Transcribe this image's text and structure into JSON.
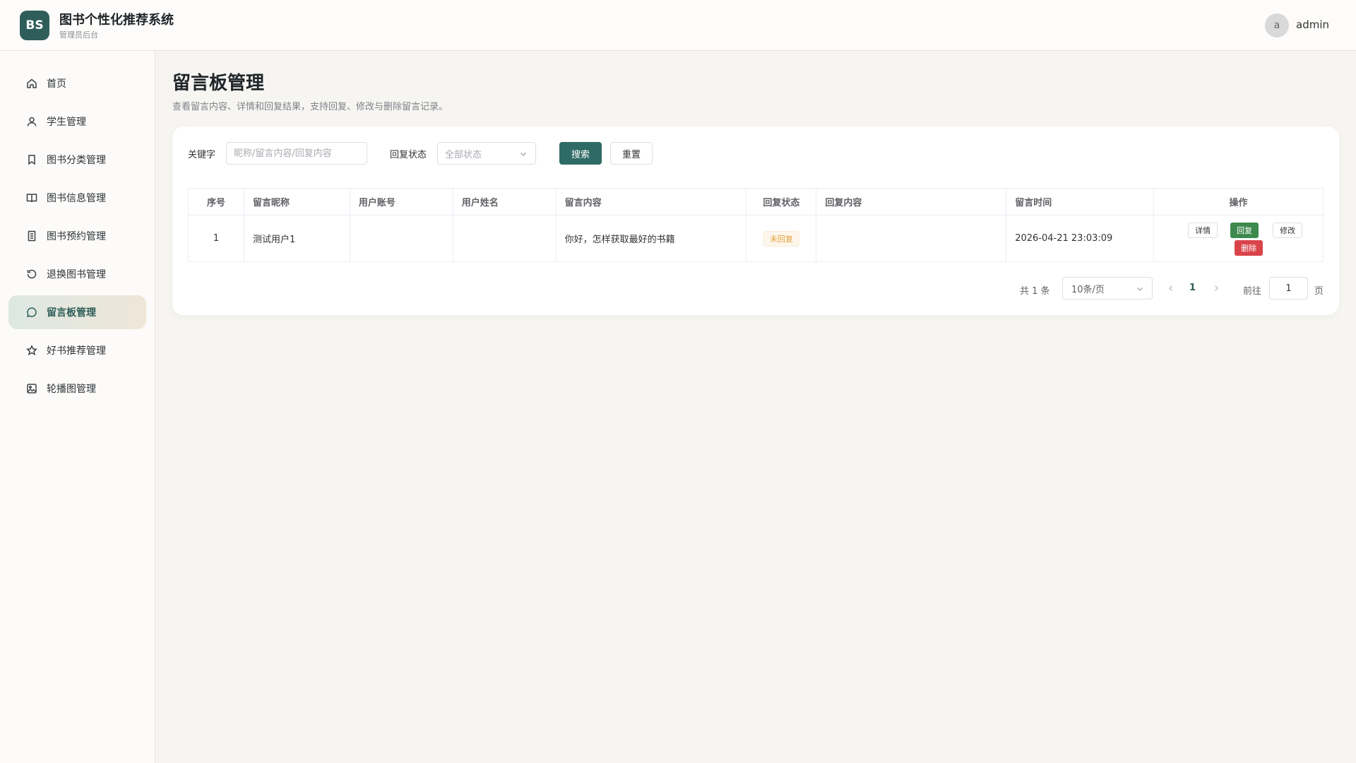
{
  "header": {
    "logo": "BS",
    "title": "图书个性化推荐系统",
    "subtitle": "管理员后台",
    "avatar_letter": "a",
    "username": "admin"
  },
  "sidebar": {
    "items": [
      {
        "label": "首页",
        "icon": "home-icon"
      },
      {
        "label": "学生管理",
        "icon": "user-icon"
      },
      {
        "label": "图书分类管理",
        "icon": "bookmark-icon"
      },
      {
        "label": "图书信息管理",
        "icon": "book-open-icon"
      },
      {
        "label": "图书预约管理",
        "icon": "document-icon"
      },
      {
        "label": "退换图书管理",
        "icon": "refresh-icon"
      },
      {
        "label": "留言板管理",
        "icon": "chat-icon",
        "active": true
      },
      {
        "label": "好书推荐管理",
        "icon": "star-icon"
      },
      {
        "label": "轮播图管理",
        "icon": "image-icon"
      }
    ]
  },
  "main": {
    "title": "留言板管理",
    "description": "查看留言内容、详情和回复结果，支持回复、修改与删除留言记录。"
  },
  "filters": {
    "keyword_label": "关键字",
    "keyword_placeholder": "昵称/留言内容/回复内容",
    "status_label": "回复状态",
    "status_value": "全部状态",
    "search_label": "搜索",
    "reset_label": "重置"
  },
  "table": {
    "columns": [
      "序号",
      "留言昵称",
      "用户账号",
      "用户姓名",
      "留言内容",
      "回复状态",
      "回复内容",
      "留言时间",
      "操作"
    ],
    "rows": [
      {
        "index": "1",
        "nickname": "测试用户1",
        "account": "",
        "name": "",
        "content": "你好，怎样获取最好的书籍",
        "status": "未回复",
        "reply": "",
        "time": "2026-04-21 23:03:09"
      }
    ],
    "actions": {
      "detail": "详情",
      "reply": "回复",
      "edit": "修改",
      "delete": "删除"
    }
  },
  "pagination": {
    "total": "共 1 条",
    "page_size": "10条/页",
    "current_page": "1",
    "goto_label": "前往",
    "goto_value": "1",
    "page_suffix": "页"
  },
  "colors": {
    "brand": "#2f5e5a",
    "primary_button": "#2f6b66",
    "reply_button": "#3e8a4e",
    "delete_button": "#d9434a",
    "warning_tag": "#e6a23c"
  }
}
